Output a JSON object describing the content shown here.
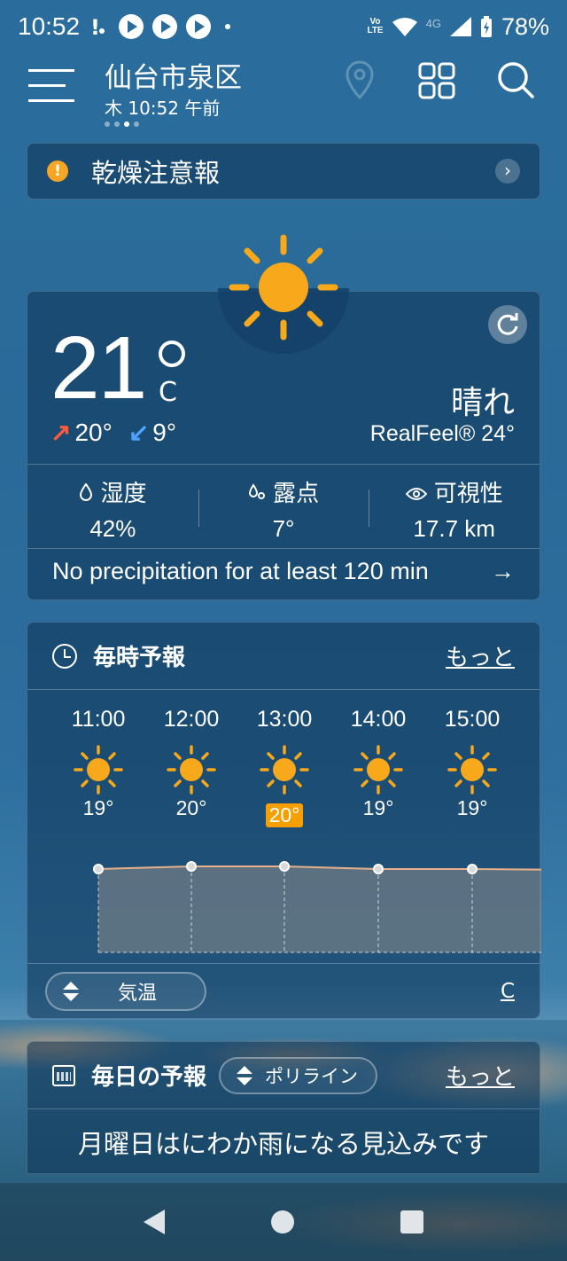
{
  "status_bar": {
    "time": "10:52",
    "network_label": "Vo​LTE",
    "network_type": "4G",
    "battery": "78%"
  },
  "header": {
    "location": "仙台市泉区",
    "subtitle": "木 10:52 午前"
  },
  "alert": {
    "label": "乾燥注意報",
    "accent_color": "#f5a623"
  },
  "current": {
    "temperature": "21°",
    "temp_number": "21",
    "unit": "C",
    "high": "20°",
    "low": "9°",
    "condition": "晴れ",
    "realfeel": "RealFeel® 24°",
    "stats": [
      {
        "icon": "droplet-icon",
        "name": "湿度",
        "value": "42%"
      },
      {
        "icon": "dewpoint-icon",
        "name": "露点",
        "value": "7°"
      },
      {
        "icon": "eye-icon",
        "name": "可視性",
        "value": "17.7 km"
      }
    ],
    "precip_text": "No precipitation for at least 120 min"
  },
  "hourly": {
    "title": "毎時予報",
    "more": "もっと",
    "hours": [
      {
        "time": "11:00",
        "temp": "19°",
        "value": 19
      },
      {
        "time": "12:00",
        "temp": "20°",
        "value": 20
      },
      {
        "time": "13:00",
        "temp": "20°",
        "value": 20,
        "highlight": true
      },
      {
        "time": "14:00",
        "temp": "19°",
        "value": 19
      },
      {
        "time": "15:00",
        "temp": "19°",
        "value": 19
      }
    ],
    "selector_label": "気温",
    "unit_link": "C"
  },
  "daily": {
    "title": "毎日の予報",
    "mode": "ポリライン",
    "more": "もっと",
    "message": "月曜日はにわか雨になる見込みです"
  },
  "colors": {
    "sun": "#f7a81b",
    "highlight": "#f5a000",
    "high_arrow": "#ff5a3c",
    "low_arrow": "#4da3ff"
  }
}
